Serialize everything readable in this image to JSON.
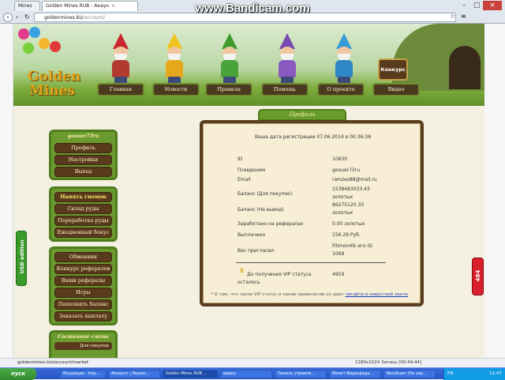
{
  "watermark": "www.Bandicam.com",
  "browser": {
    "tabs": [
      "Golden Mines RUB - Акаун"
    ],
    "small_tab": "Mines",
    "address_host": "goldenmines.biz",
    "address_path": "/account/",
    "status_url": "goldenmines.biz/account/market",
    "bandicam_status": "1280x1024   Запись [00:44:44]"
  },
  "header": {
    "logo_line1": "Golden",
    "logo_line2": "Mines",
    "nav": [
      "Главная",
      "Новости",
      "Правила",
      "Помощь",
      "О проекте",
      "Видео"
    ],
    "contest_label": "Конкурс"
  },
  "sidebar": {
    "user": {
      "title": "goouer73ru",
      "items": [
        "Профиль",
        "Настройки",
        "Выход"
      ]
    },
    "mine": {
      "items": [
        "Нанять гномов",
        "Склад руды",
        "Переработка руды",
        "Ежедневный бонус"
      ]
    },
    "money": {
      "items": [
        "Обменник",
        "Конкурс рефералов",
        "Ваши рефералы",
        "Игры",
        "Пополнить баланс",
        "Заказать выплату"
      ]
    },
    "stats": {
      "title": "Состояние счета",
      "items": [
        "Для покупок"
      ]
    }
  },
  "side_badges": {
    "left": "USD edition",
    "right": "484"
  },
  "profile": {
    "title": "Профиль",
    "reg_date": "Ваша дата регистрации 07.06.2014 в 00:36:38",
    "rows": [
      {
        "label": "ID",
        "value": "10830"
      },
      {
        "label": "Псевдоним",
        "value": "goouer73ru"
      },
      {
        "label": "Email",
        "value": "ramzes88@mail.ru"
      },
      {
        "label": "Баланс (Для покупок)",
        "value": "1538483033.43",
        "value2": "золотых"
      },
      {
        "label": "Баланс (На вывод)",
        "value": "86275120.33",
        "value2": "золотых"
      },
      {
        "label": "Заработано на рефералах",
        "value": "0.00 золотых"
      },
      {
        "label": "Выплачено",
        "value": "156.29 Руб."
      },
      {
        "label": "Вас пригласил",
        "value": "Filimon4ik его ID",
        "value2": "1068"
      }
    ],
    "vip_label1": "До получения VIP статуса",
    "vip_label2": "осталось",
    "vip_value": "4959",
    "note_prefix": "* О том, что такое VIP статус и какие привилегии он дает ",
    "note_link": "читайте в новостной ленте"
  },
  "taskbar": {
    "start": "пуск",
    "buttons": [
      "Входящие - Imp...",
      "Аккаунт | Payeer...",
      "Golden Mines RUB ...",
      "видео",
      "Панель управле...",
      "Монет Видеореда...",
      "Bandicam (Не зар..."
    ],
    "lang": "EN",
    "clock": "11:47"
  },
  "colors": {
    "green": "#6a9c2a",
    "brown": "#5a3a1d",
    "panel": "#f7eed5",
    "accent_red": "#d8202c"
  }
}
